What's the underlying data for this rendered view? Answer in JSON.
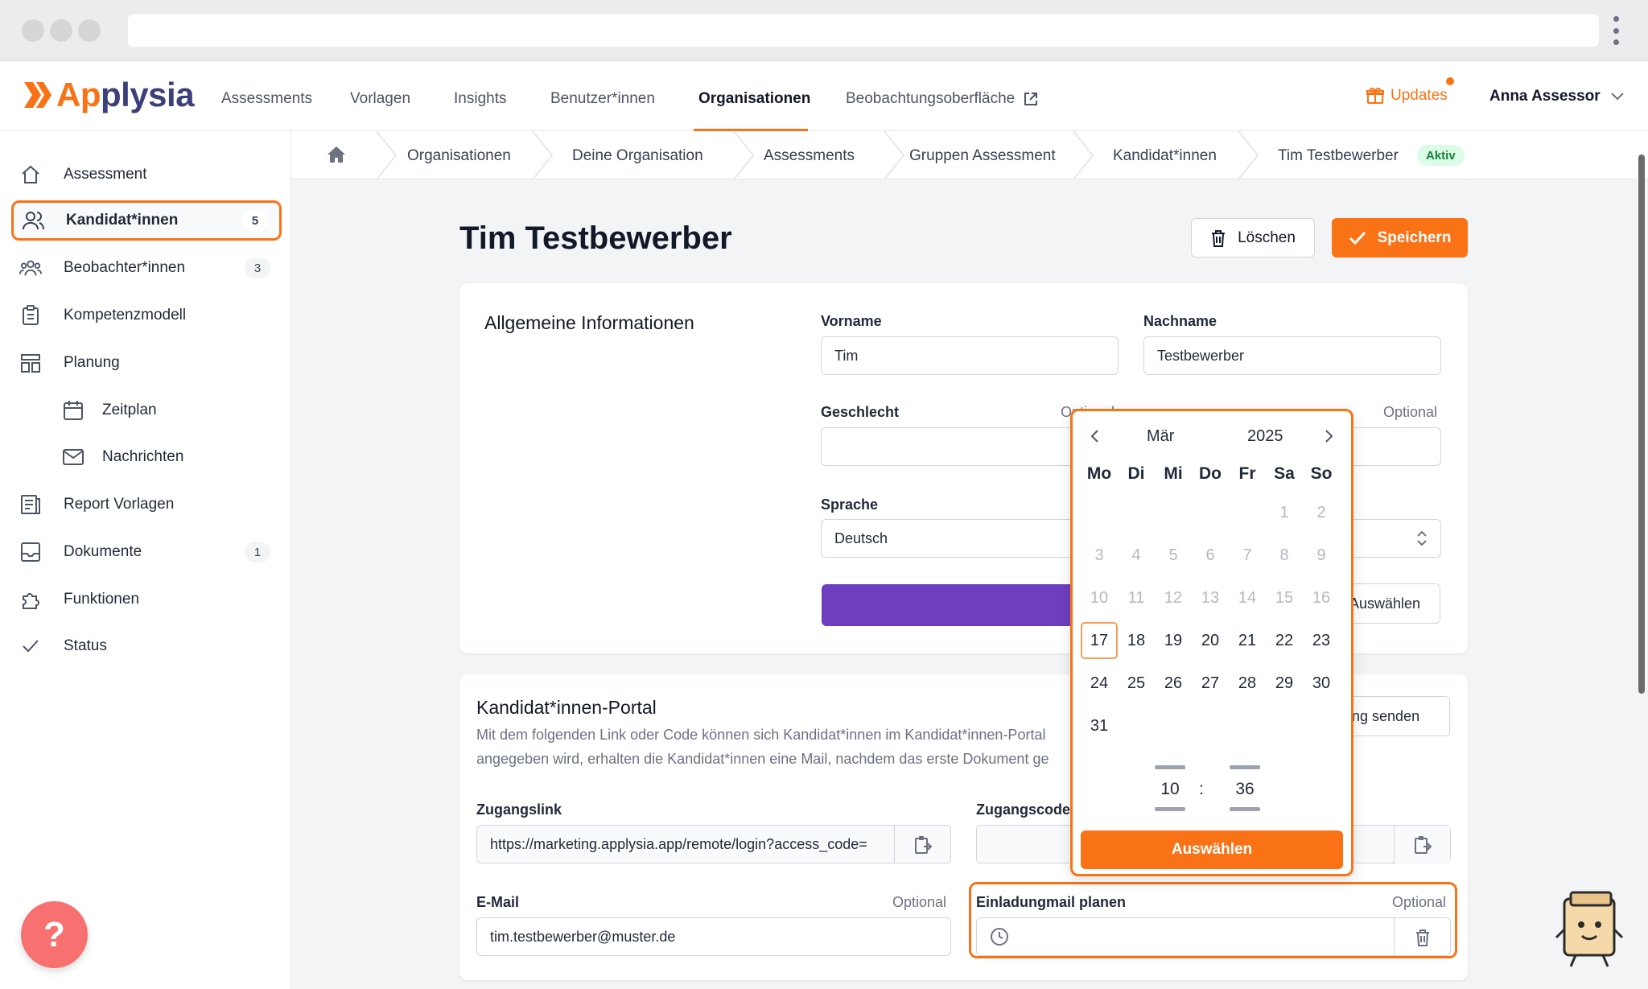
{
  "brand": {
    "name_part1": "Ap",
    "name_part2": "plysia",
    "accent": "#f97316"
  },
  "topnav": {
    "items": [
      "Assessments",
      "Vorlagen",
      "Insights",
      "Benutzer*innen",
      "Organisationen",
      "Beobachtungsoberfläche"
    ],
    "active": "Organisationen",
    "updates_label": "Updates",
    "user_name": "Anna Assessor"
  },
  "sidebar": {
    "items": [
      {
        "label": "Assessment",
        "icon": "home-icon"
      },
      {
        "label": "Kandidat*innen",
        "icon": "users-icon",
        "badge": "5",
        "active": true
      },
      {
        "label": "Beobachter*innen",
        "icon": "group-icon",
        "badge": "3"
      },
      {
        "label": "Kompetenzmodell",
        "icon": "clipboard-icon"
      },
      {
        "label": "Planung",
        "icon": "layout-icon"
      },
      {
        "label": "Zeitplan",
        "icon": "calendar-icon"
      },
      {
        "label": "Nachrichten",
        "icon": "mail-icon"
      },
      {
        "label": "Report Vorlagen",
        "icon": "report-icon"
      },
      {
        "label": "Dokumente",
        "icon": "inbox-icon",
        "badge": "1"
      },
      {
        "label": "Funktionen",
        "icon": "puzzle-icon"
      },
      {
        "label": "Status",
        "icon": "check-icon"
      }
    ]
  },
  "breadcrumb": {
    "items": [
      "Organisationen",
      "Deine Organisation",
      "Assessments",
      "Gruppen Assessment",
      "Kandidat*innen",
      "Tim Testbewerber"
    ],
    "status_badge": "Aktiv"
  },
  "page": {
    "title": "Tim Testbewerber",
    "delete_label": "Löschen",
    "save_label": "Speichern"
  },
  "general": {
    "title": "Allgemeine Informationen",
    "vorname_label": "Vorname",
    "vorname_value": "Tim",
    "nachname_label": "Nachname",
    "nachname_value": "Testbewerber",
    "geschlecht_label": "Geschlecht",
    "geschlecht_optional": "Optional",
    "right_optional": "Optional",
    "sprache_label": "Sprache",
    "sprache_value": "Deutsch",
    "auswaehlen_label": "Auswählen"
  },
  "portal": {
    "title": "Kandidat*innen-Portal",
    "desc_line1": "Mit dem folgenden Link oder Code können sich Kandidat*innen im Kandidat*innen-Portal",
    "desc_line2": "angegeben wird, erhalten die Kandidat*innen eine Mail, nachdem das erste Dokument ge",
    "send_label": "ung senden",
    "zugangslink_label": "Zugangslink",
    "zugangslink_value": "https://marketing.applysia.app/remote/login?access_code=",
    "zugangscode_label": "Zugangscode",
    "email_label": "E-Mail",
    "email_optional": "Optional",
    "email_value": "tim.testbewerber@muster.de",
    "mail_label": "Einladungmail planen",
    "mail_optional": "Optional"
  },
  "picker": {
    "month": "Mär",
    "year": "2025",
    "weekdays": [
      "Mo",
      "Di",
      "Mi",
      "Do",
      "Fr",
      "Sa",
      "So"
    ],
    "weeks": [
      [
        "",
        "",
        "",
        "",
        "",
        "1",
        "2"
      ],
      [
        "3",
        "4",
        "5",
        "6",
        "7",
        "8",
        "9"
      ],
      [
        "10",
        "11",
        "12",
        "13",
        "14",
        "15",
        "16"
      ],
      [
        "17",
        "18",
        "19",
        "20",
        "21",
        "22",
        "23"
      ],
      [
        "24",
        "25",
        "26",
        "27",
        "28",
        "29",
        "30"
      ],
      [
        "31",
        "",
        "",
        "",
        "",
        "",
        ""
      ]
    ],
    "today": "17",
    "disabled_before": 17,
    "hour": "10",
    "separator": ":",
    "minute": "36",
    "select_label": "Auswählen"
  },
  "help_label": "?"
}
